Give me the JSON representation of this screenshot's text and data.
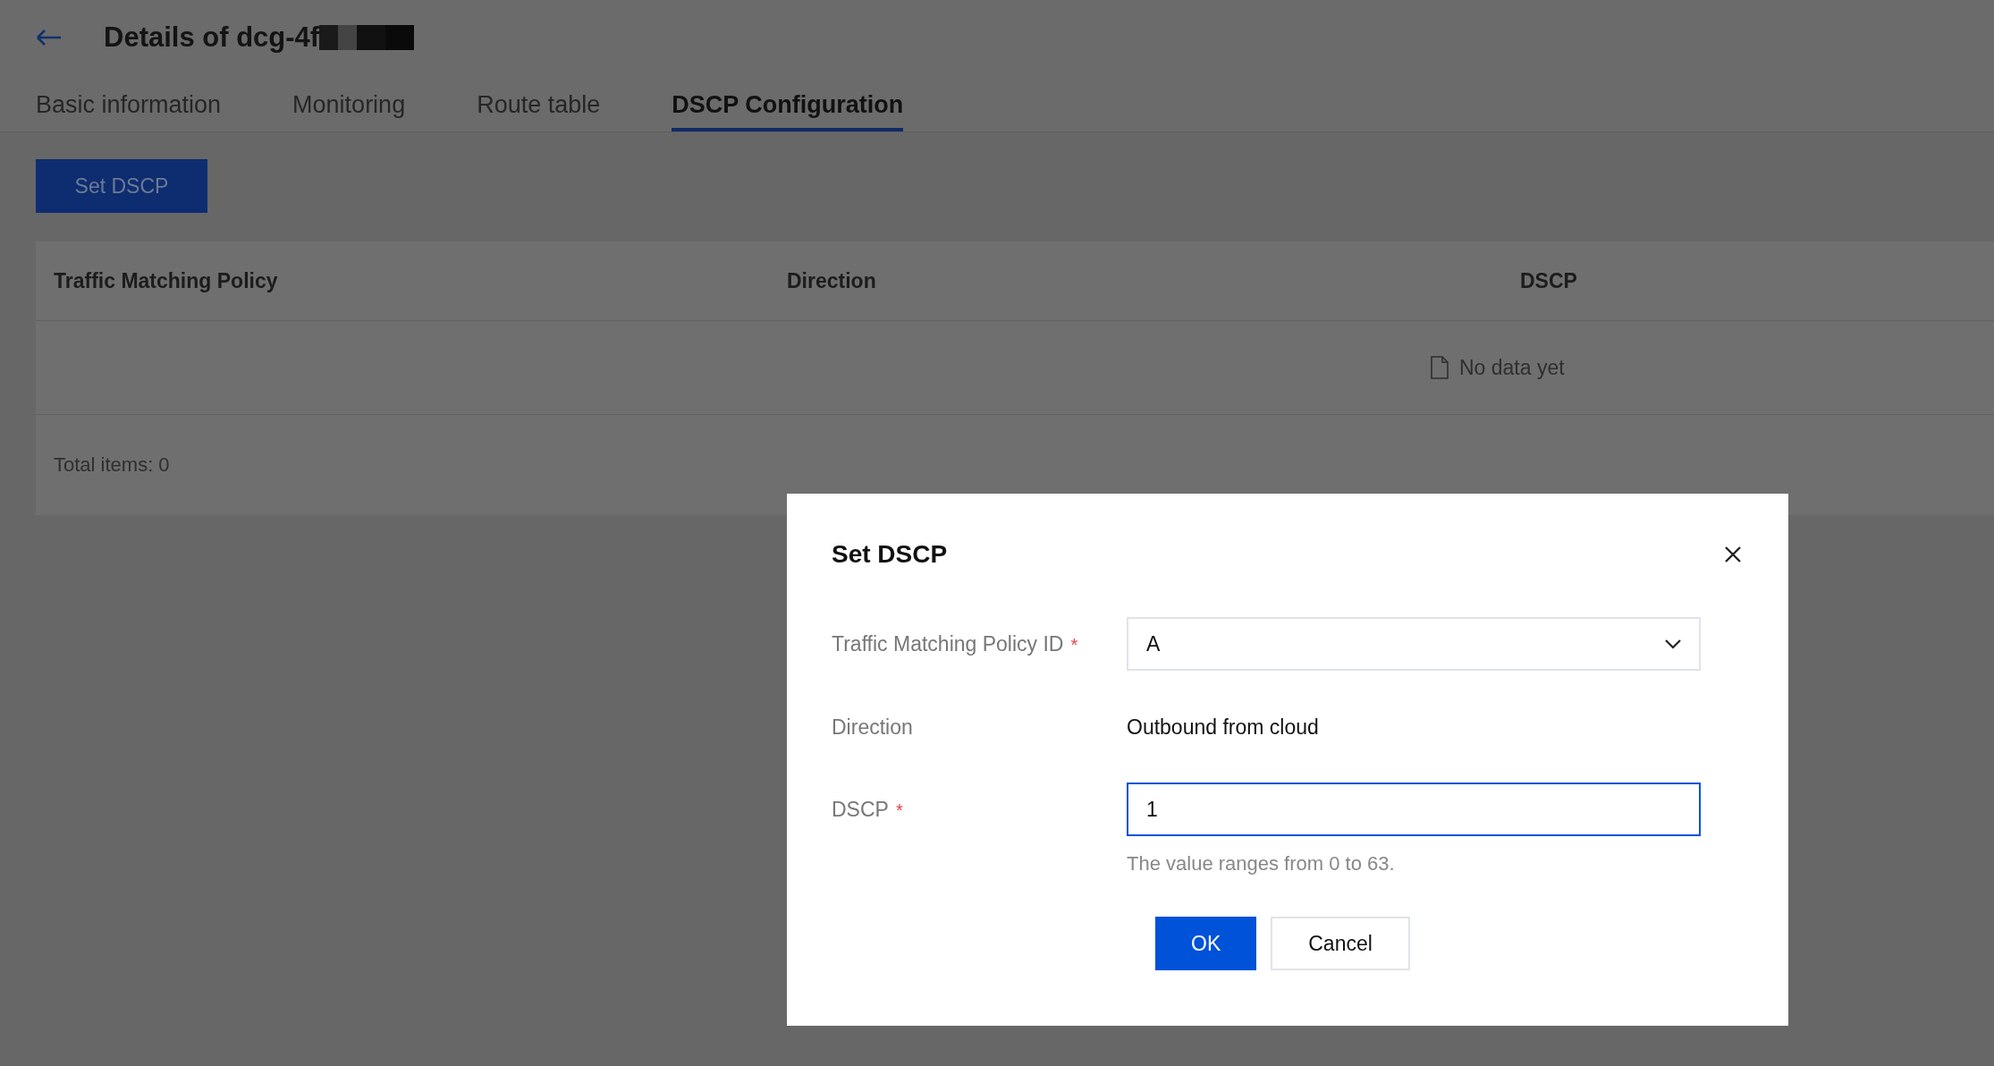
{
  "header": {
    "title": "Details of dcg-4f"
  },
  "tabs": [
    {
      "label": "Basic information",
      "selected": false
    },
    {
      "label": "Monitoring",
      "selected": false
    },
    {
      "label": "Route table",
      "selected": false
    },
    {
      "label": "DSCP Configuration",
      "selected": true
    }
  ],
  "toolbar": {
    "button": "Set DSCP"
  },
  "table": {
    "columns": [
      "Traffic Matching Policy",
      "Direction",
      "DSCP"
    ],
    "empty_text": "No data yet",
    "footer": "Total items: 0"
  },
  "dialog": {
    "title": "Set DSCP",
    "fields": [
      {
        "kind": "select",
        "label": "Traffic Matching Policy ID",
        "required_mark": "*",
        "value": "A"
      },
      {
        "kind": "text",
        "label": "Direction",
        "value": "Outbound from cloud"
      },
      {
        "kind": "input",
        "label": "DSCP",
        "required_mark": "*",
        "value": "1",
        "focused": true,
        "help": "The value ranges from 0 to 63."
      }
    ],
    "buttons": [
      {
        "label": "OK",
        "primary": true
      },
      {
        "label": "Cancel",
        "primary": false
      }
    ]
  }
}
